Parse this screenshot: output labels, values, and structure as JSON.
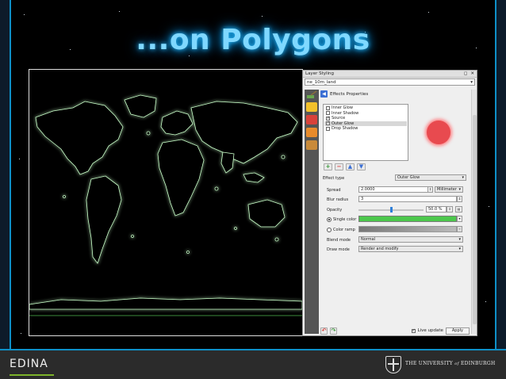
{
  "slide": {
    "title": "...on Polygons"
  },
  "panel": {
    "title": "Layer Styling",
    "layer_name": "ne_10m_land",
    "effects_header": "Effects Properties",
    "effects": [
      {
        "label": "Inner Glow",
        "checked": false
      },
      {
        "label": "Inner Shadow",
        "checked": false
      },
      {
        "label": "Source",
        "checked": true
      },
      {
        "label": "Outer Glow",
        "checked": true,
        "selected": true
      },
      {
        "label": "Drop Shadow",
        "checked": false
      }
    ],
    "effect_type_label": "Effect type",
    "effect_type_value": "Outer Glow",
    "spread_label": "Spread",
    "spread_value": "2.0000",
    "spread_unit": "Millimeter",
    "blur_label": "Blur radius",
    "blur_value": "3",
    "opacity_label": "Opacity",
    "opacity_value": "50.0 %",
    "opacity_fraction": 0.5,
    "single_color_label": "Single color",
    "single_color": "#4cc84c",
    "color_ramp_label": "Color ramp",
    "blend_label": "Blend mode",
    "blend_value": "Normal",
    "draw_label": "Draw mode",
    "draw_value": "Render and modify",
    "live_update_label": "Live update",
    "apply_label": "Apply"
  },
  "footer": {
    "brand": "EDINA",
    "university_prefix": "THE UNIVERSITY",
    "university_of": "of",
    "university_suffix": "EDINBURGH"
  },
  "colors": {
    "title_glow": "#29b6f6",
    "frame_accent": "#0e90c8",
    "glow": "#7dff7d",
    "preview_circle": "#e84a4f"
  }
}
